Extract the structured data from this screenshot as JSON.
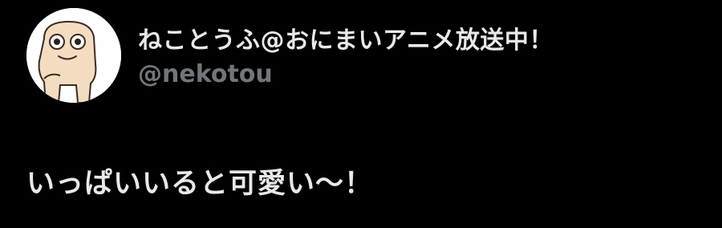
{
  "tweet": {
    "author": {
      "display_name": "ねことうふ@おにまいアニメ放送中！",
      "handle": "@nekotou",
      "avatar_icon": "cat-tofu-avatar-icon"
    },
    "text": "いっぱいいると可愛い～！"
  },
  "colors": {
    "background": "#000000",
    "text_primary": "#e7e9ea",
    "text_secondary": "#71767b",
    "avatar_bg": "#ffffff",
    "avatar_character": "#f4dcc0"
  }
}
